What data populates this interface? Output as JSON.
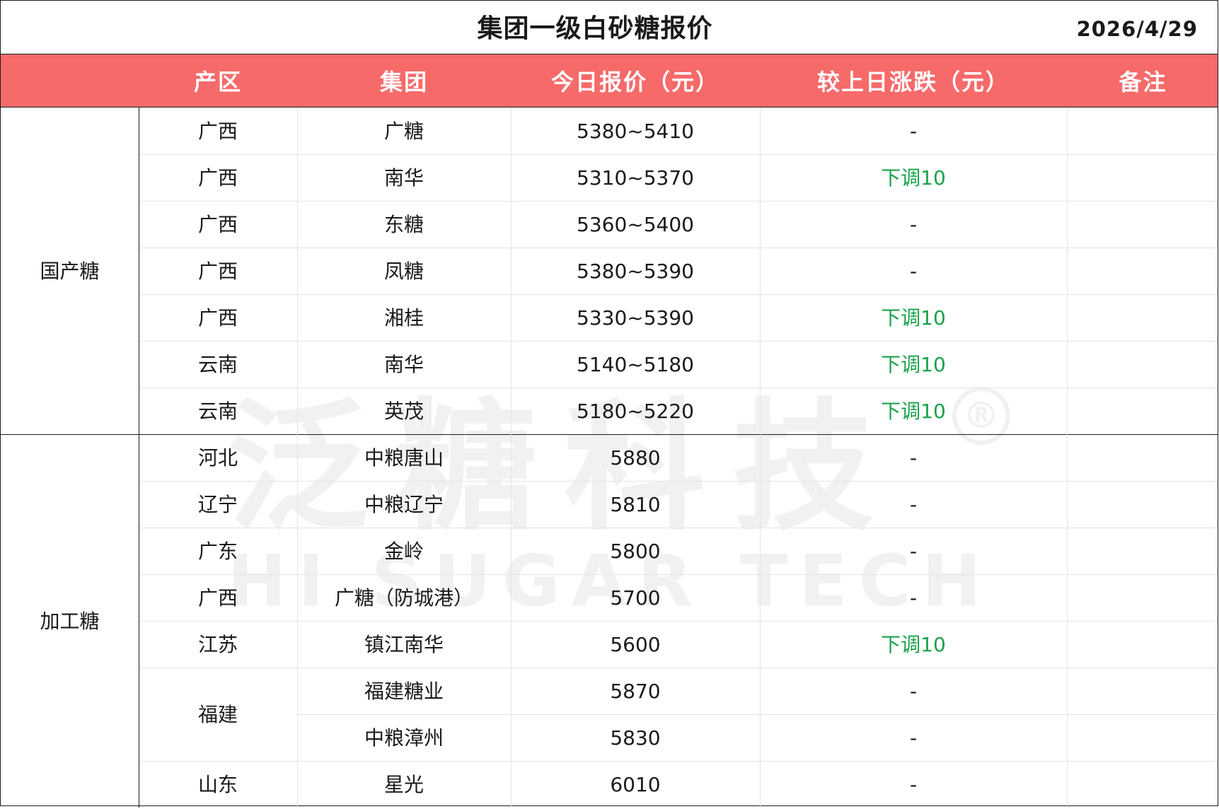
{
  "title": "集团一级白砂糖报价",
  "date": "2026/4/29",
  "header": {
    "region": "产区",
    "group": "集团",
    "today_price": "今日报价（元）",
    "change": "较上日涨跌（元）",
    "note": "备注"
  },
  "colors": {
    "header_bg": "#f66a6a",
    "header_text": "#ffffff",
    "down": "#1aa34a"
  },
  "watermark": {
    "cn": "泛糖科技",
    "en": "HI SUGAR TECH",
    "reg": "®"
  },
  "groups": [
    {
      "label": "国产糖",
      "rows": [
        {
          "region": "广西",
          "group": "广糖",
          "price": "5380~5410",
          "change": "-",
          "note": ""
        },
        {
          "region": "广西",
          "group": "南华",
          "price": "5310~5370",
          "change": "下调10",
          "note": ""
        },
        {
          "region": "广西",
          "group": "东糖",
          "price": "5360~5400",
          "change": "-",
          "note": ""
        },
        {
          "region": "广西",
          "group": "凤糖",
          "price": "5380~5390",
          "change": "-",
          "note": ""
        },
        {
          "region": "广西",
          "group": "湘桂",
          "price": "5330~5390",
          "change": "下调10",
          "note": ""
        },
        {
          "region": "云南",
          "group": "南华",
          "price": "5140~5180",
          "change": "下调10",
          "note": ""
        },
        {
          "region": "云南",
          "group": "英茂",
          "price": "5180~5220",
          "change": "下调10",
          "note": ""
        }
      ]
    },
    {
      "label": "加工糖",
      "rows": [
        {
          "region": "河北",
          "group": "中粮唐山",
          "price": "5880",
          "change": "-",
          "note": ""
        },
        {
          "region": "辽宁",
          "group": "中粮辽宁",
          "price": "5810",
          "change": "-",
          "note": ""
        },
        {
          "region": "广东",
          "group": "金岭",
          "price": "5800",
          "change": "-",
          "note": ""
        },
        {
          "region": "广西",
          "group": "广糖（防城港）",
          "price": "5700",
          "change": "-",
          "note": ""
        },
        {
          "region": "江苏",
          "group": "镇江南华",
          "price": "5600",
          "change": "下调10",
          "note": ""
        },
        {
          "region": "福建",
          "group": "福建糖业",
          "price": "5870",
          "change": "-",
          "note": ""
        },
        {
          "region": "福建",
          "group": "中粮漳州",
          "price": "5830",
          "change": "-",
          "note": ""
        },
        {
          "region": "山东",
          "group": "星光",
          "price": "6010",
          "change": "-",
          "note": ""
        }
      ]
    }
  ]
}
